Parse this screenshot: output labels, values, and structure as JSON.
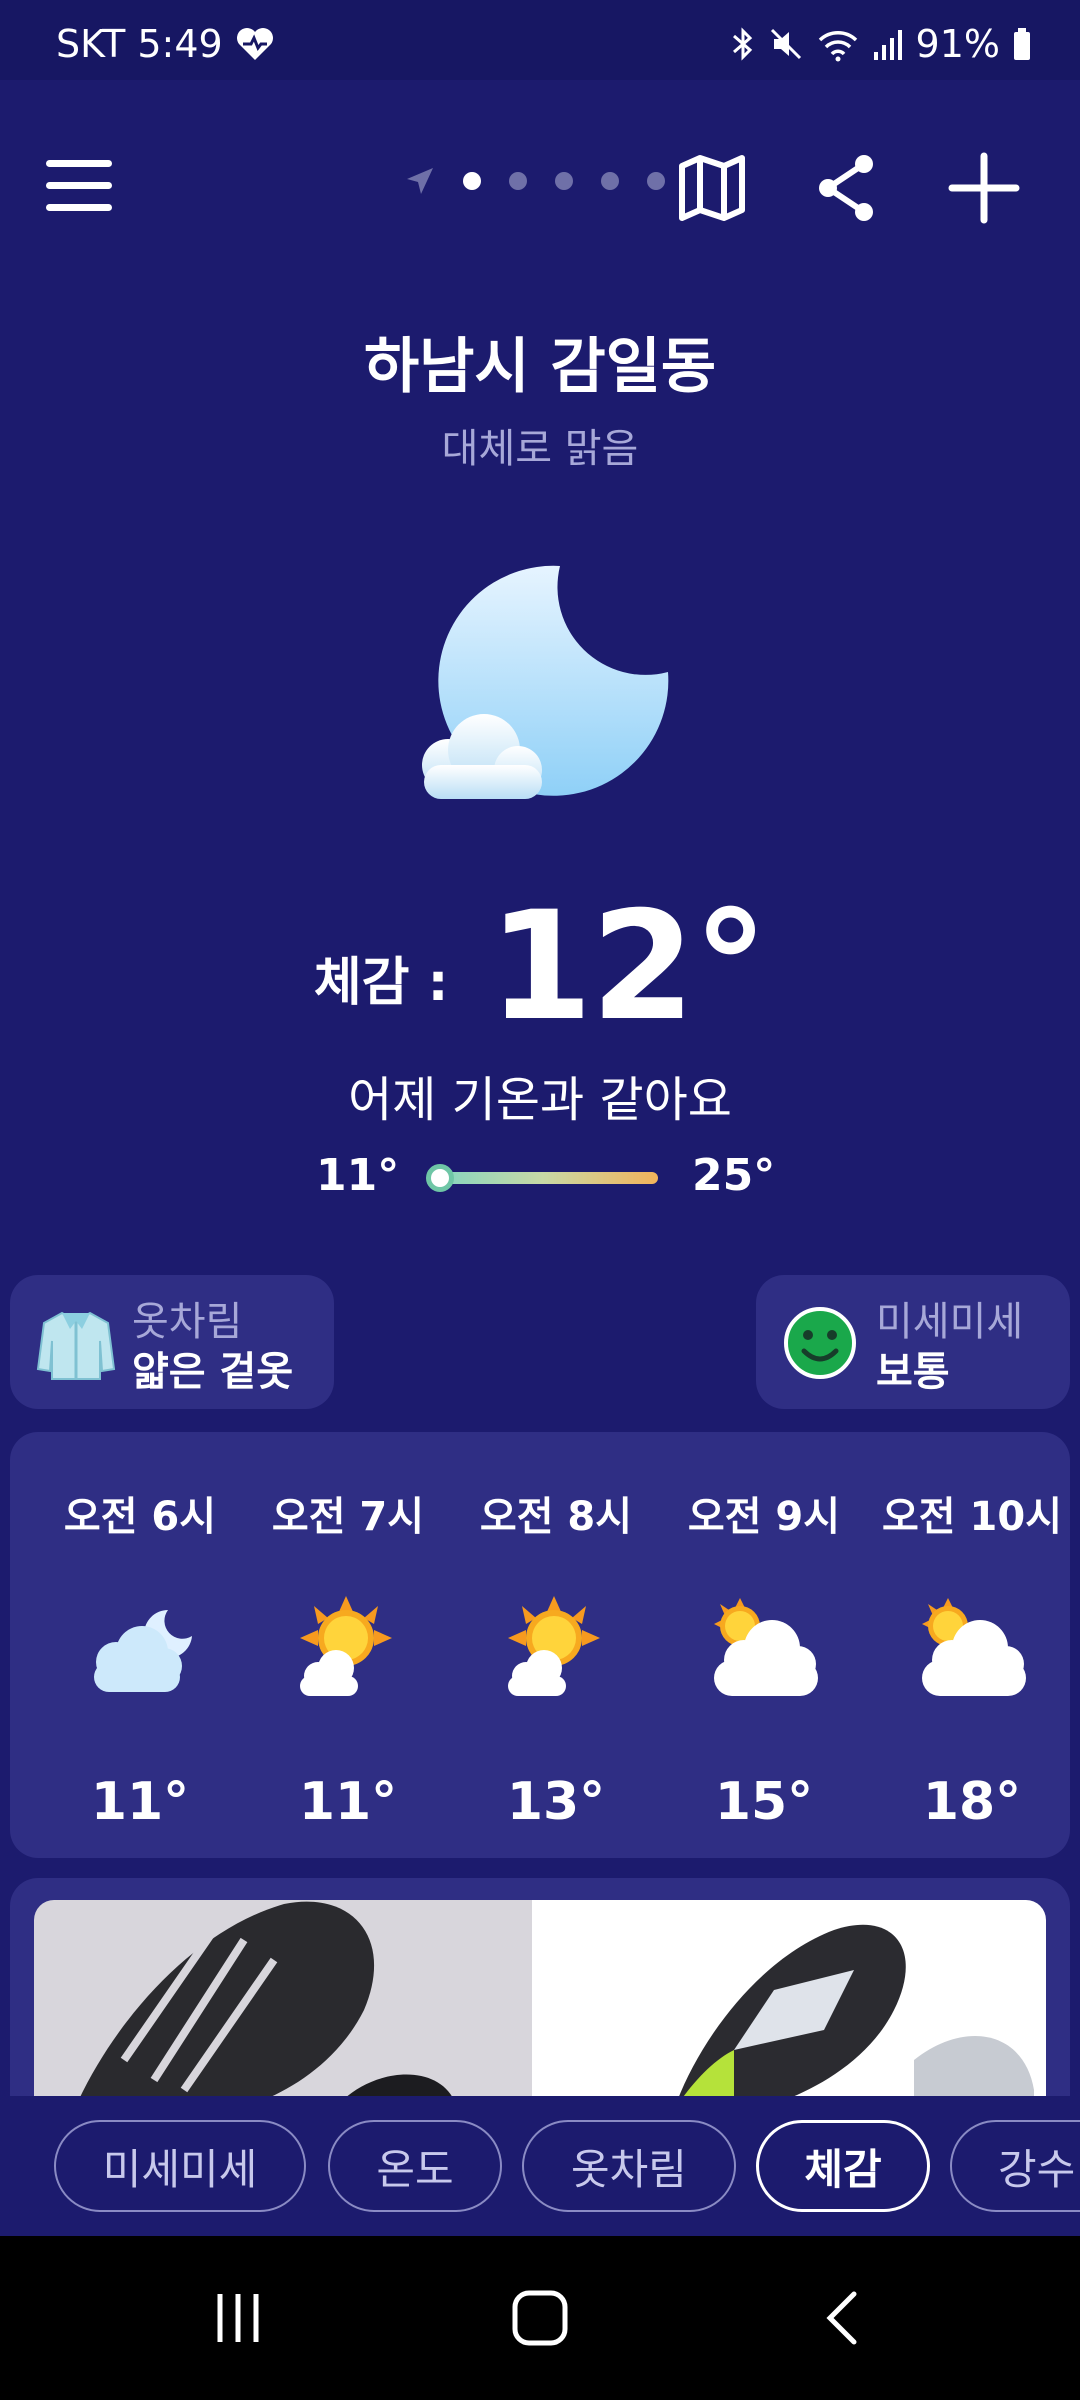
{
  "status_bar": {
    "carrier_time": "SKT 5:49",
    "battery": "91%",
    "icons": [
      "health-icon",
      "bluetooth-icon",
      "mute-icon",
      "wifi-icon",
      "signal-icon",
      "battery-icon"
    ]
  },
  "header": {
    "icons": [
      "menu-icon",
      "location-arrow-icon",
      "map-icon",
      "share-icon",
      "plus-icon"
    ]
  },
  "weather": {
    "location": "하남시 감일동",
    "condition": "대체로 맑음",
    "condition_icon": "moon-cloud-icon",
    "feels_label": "체감 :",
    "feels_temp": "12°",
    "comparison": "어제 기온과 같아요",
    "min_temp": "11°",
    "max_temp": "25°",
    "current_level": 0.05
  },
  "chips": {
    "clothing": {
      "title": "옷차림",
      "value": "얇은 겉옷",
      "icon": "jacket-icon"
    },
    "dust": {
      "title": "미세미세",
      "value": "보통",
      "icon": "smiley-icon"
    }
  },
  "hourly": [
    {
      "time": "오전 6시",
      "icon": "moon-cloud-icon",
      "temp": "11°"
    },
    {
      "time": "오전 7시",
      "icon": "sun-cloud-icon",
      "temp": "11°"
    },
    {
      "time": "오전 8시",
      "icon": "sun-cloud-icon",
      "temp": "13°"
    },
    {
      "time": "오전 9시",
      "icon": "cloud-sun-icon",
      "temp": "15°"
    },
    {
      "time": "오전 10시",
      "icon": "cloud-sun-icon",
      "temp": "18°"
    }
  ],
  "ad": {
    "image": "shoe-ad-image"
  },
  "tabs": [
    {
      "label": "미세미세",
      "active": false
    },
    {
      "label": "온도",
      "active": false
    },
    {
      "label": "옷차림",
      "active": false
    },
    {
      "label": "체감",
      "active": true
    },
    {
      "label": "강수",
      "active": false
    }
  ],
  "colors": {
    "background": "#1c1b6e",
    "card": "#2f2e84",
    "muted_text": "#a7a8d8"
  }
}
